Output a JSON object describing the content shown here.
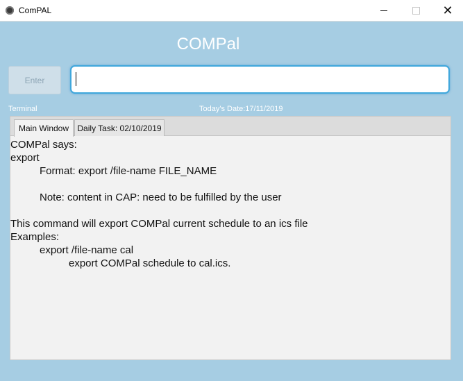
{
  "window": {
    "title": "ComPAL",
    "minimize": "—",
    "maximize": "□",
    "close": "✕"
  },
  "app": {
    "heading": "COMPal"
  },
  "input_bar": {
    "enter_label": "Enter",
    "command_value": ""
  },
  "status": {
    "terminal_label": "Terminal",
    "date_text": "Today's Date:17/11/2019"
  },
  "tabs": [
    {
      "label": "Main Window"
    },
    {
      "label": "Daily Task: 02/10/2019"
    }
  ],
  "output": {
    "line1": "COMPal says:",
    "line2": "export",
    "line3": "Format: export /file-name FILE_NAME",
    "line4": "Note: content in CAP: need to be fulfilled by the user",
    "line5": "This command will export COMPal current schedule to an ics file",
    "line6": "Examples:",
    "line7": "export /file-name cal",
    "line8": "export COMPal schedule to cal.ics."
  },
  "colors": {
    "background": "#a6cde3",
    "input_focus": "#3fa7dc",
    "panel": "#f2f2f2"
  }
}
